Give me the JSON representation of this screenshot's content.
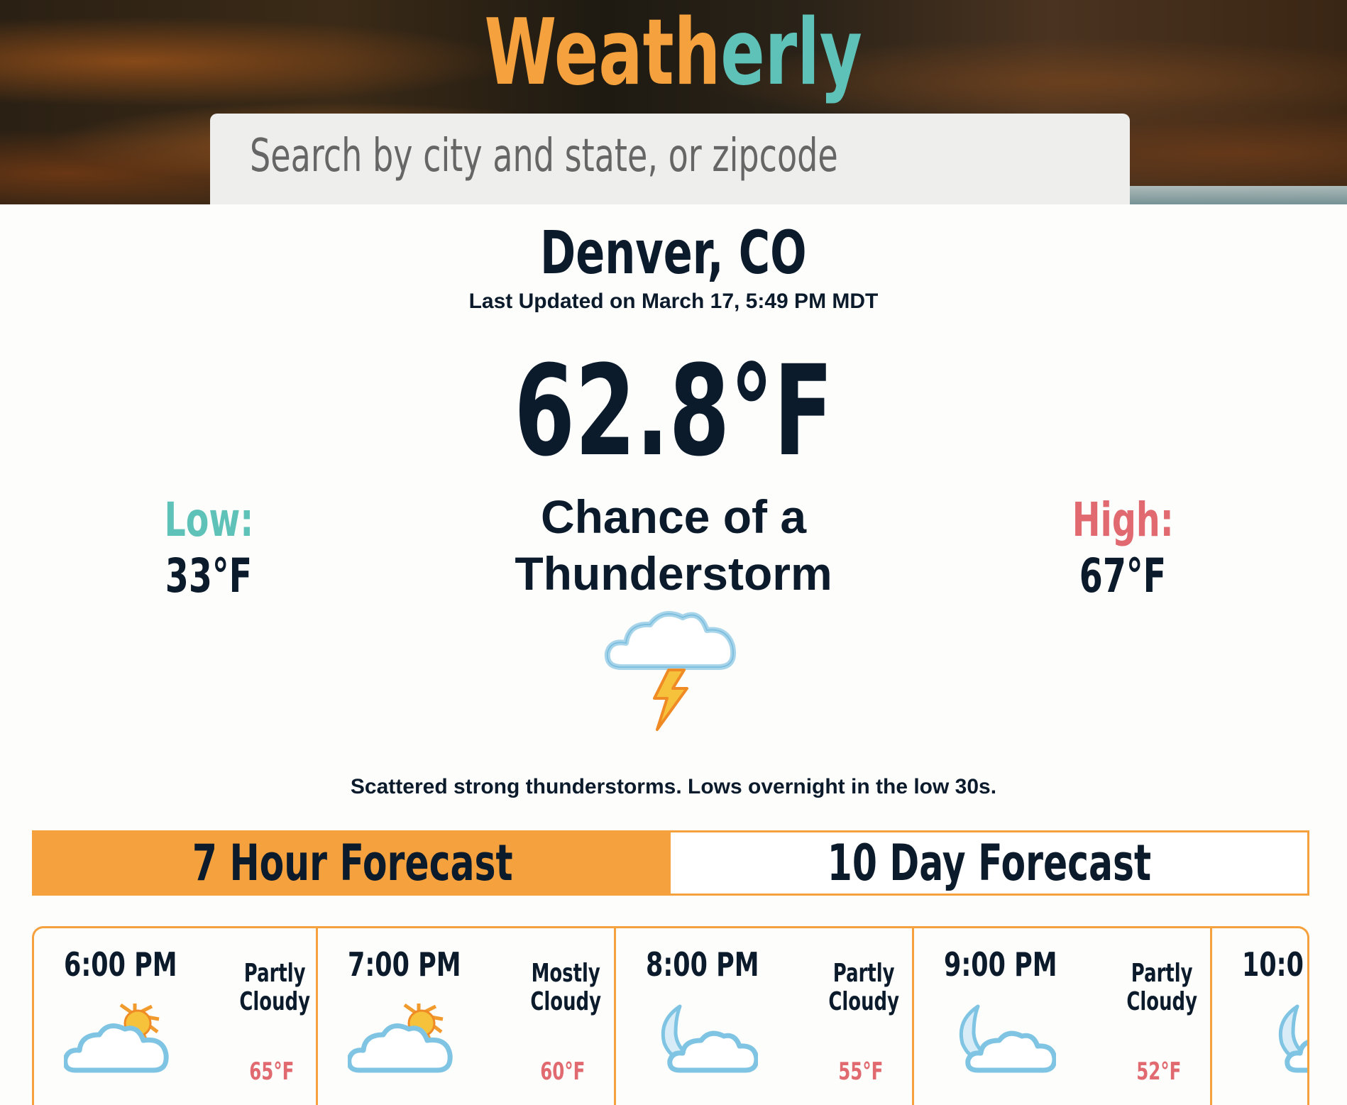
{
  "app": {
    "logo_part1": "Weath",
    "logo_part2": "erly"
  },
  "search": {
    "placeholder": "Search by city and state, or zipcode",
    "value": ""
  },
  "current": {
    "location": "Denver, CO",
    "last_updated": "Last Updated on March 17, 5:49 PM MDT",
    "temperature": "62.8°F",
    "condition_line1": "Chance of a",
    "condition_line2": "Thunderstorm",
    "condition_icon": "thunderstorm-icon",
    "low_label": "Low:",
    "low_value": "33°F",
    "high_label": "High:",
    "high_value": "67°F",
    "summary": "Scattered strong thunderstorms. Lows overnight in the low 30s."
  },
  "tabs": [
    {
      "label": "7 Hour Forecast",
      "active": true
    },
    {
      "label": "10 Day Forecast",
      "active": false
    }
  ],
  "hourly": [
    {
      "time": "6:00 PM",
      "cond1": "Partly",
      "cond2": "Cloudy",
      "temp": "65°F",
      "icon": "partly-cloudy-day-icon"
    },
    {
      "time": "7:00 PM",
      "cond1": "Mostly",
      "cond2": "Cloudy",
      "temp": "60°F",
      "icon": "partly-cloudy-day-icon"
    },
    {
      "time": "8:00 PM",
      "cond1": "Partly",
      "cond2": "Cloudy",
      "temp": "55°F",
      "icon": "partly-cloudy-night-icon"
    },
    {
      "time": "9:00 PM",
      "cond1": "Partly",
      "cond2": "Cloudy",
      "temp": "52°F",
      "icon": "partly-cloudy-night-icon"
    },
    {
      "time": "10:0",
      "cond1": "",
      "cond2": "",
      "temp": "",
      "icon": "partly-cloudy-night-icon"
    }
  ],
  "colors": {
    "orange": "#f4a13e",
    "teal": "#5fc2b8",
    "red": "#e06a6f",
    "navy": "#0c1b2b"
  }
}
